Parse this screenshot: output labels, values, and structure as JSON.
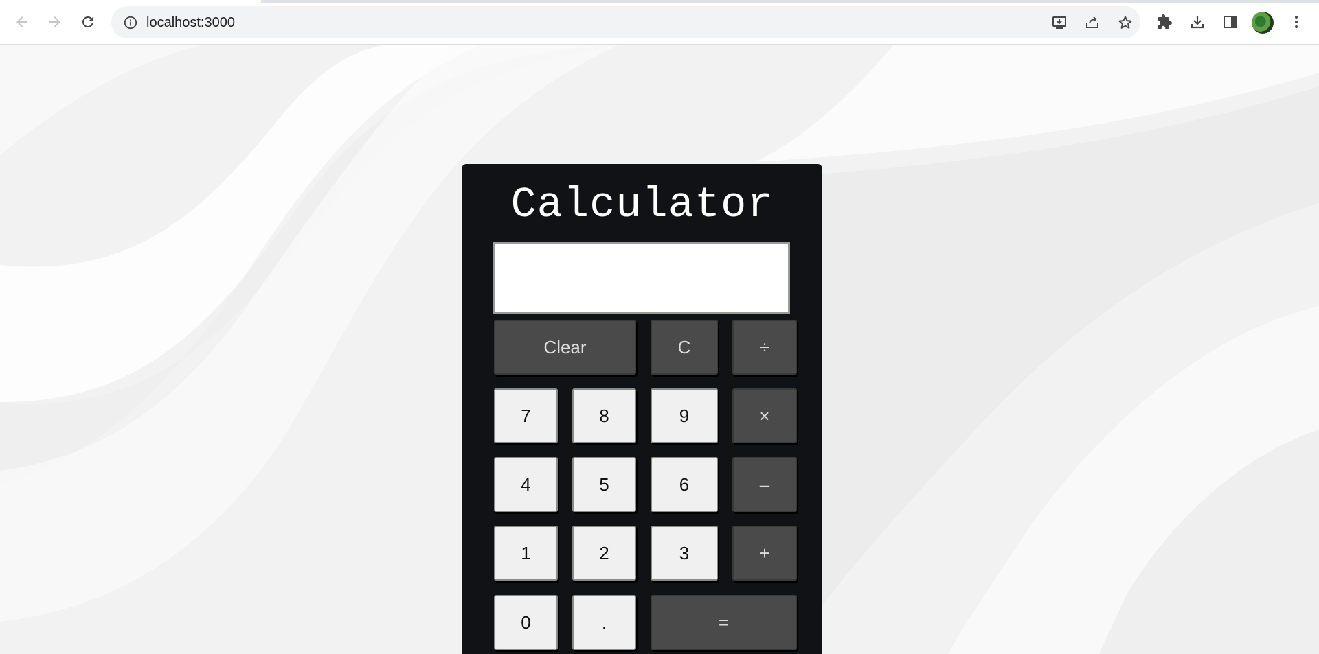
{
  "browser": {
    "url": "localhost:3000",
    "icons": {
      "back": "arrow-left-icon",
      "forward": "arrow-right-icon",
      "reload": "reload-icon",
      "site_info": "info-icon",
      "install": "install-icon",
      "share": "share-icon",
      "bookmark": "star-icon",
      "extensions": "puzzle-icon",
      "downloads": "download-icon",
      "side_panel": "side-panel-icon",
      "menu": "kebab-menu-icon"
    }
  },
  "calculator": {
    "title": "Calculator",
    "display_value": "",
    "keys": {
      "clear": "Clear",
      "backspace": "C",
      "divide": "÷",
      "seven": "7",
      "eight": "8",
      "nine": "9",
      "multiply": "×",
      "four": "4",
      "five": "5",
      "six": "6",
      "subtract": "–",
      "one": "1",
      "two": "2",
      "three": "3",
      "add": "+",
      "zero": "0",
      "decimal": ".",
      "equals": "="
    }
  },
  "colors": {
    "calculator_bg": "#111216",
    "key_light": "#f0f0f0",
    "key_dark": "#4a4a4a",
    "page_bg": "#f3f3f3"
  }
}
